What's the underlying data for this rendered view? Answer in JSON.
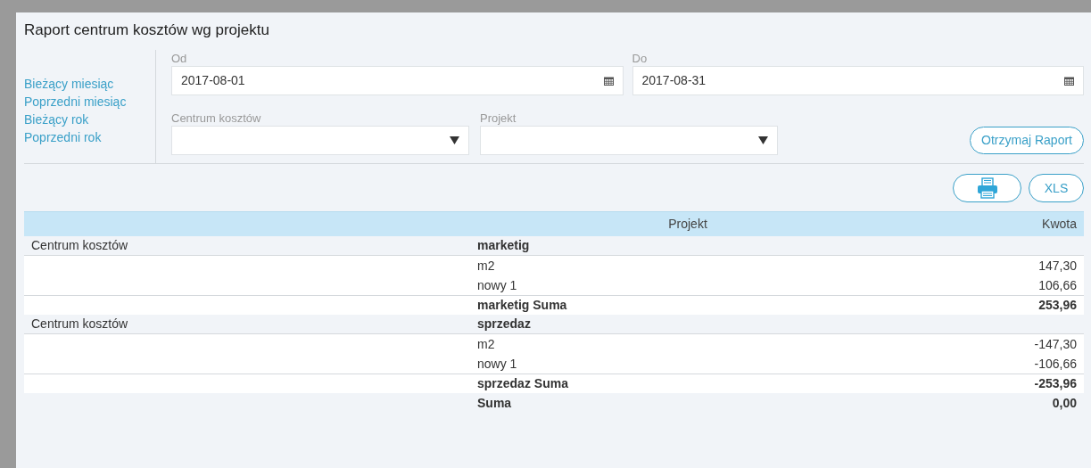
{
  "title": "Raport centrum kosztów wg projektu",
  "quick_ranges": [
    "Bieżący miesiąc",
    "Poprzedni miesiąc",
    "Bieżący rok",
    "Poprzedni rok"
  ],
  "date_from": {
    "label": "Od",
    "value": "2017-08-01"
  },
  "date_to": {
    "label": "Do",
    "value": "2017-08-31"
  },
  "cost_center": {
    "label": "Centrum kosztów"
  },
  "project": {
    "label": "Projekt"
  },
  "get_report_button": "Otrzymaj Raport",
  "export_buttons": [
    {
      "kind": "pdf"
    },
    {
      "kind": "xls",
      "label": "XLS"
    }
  ],
  "table": {
    "columns": [
      "Projekt",
      "Kwota"
    ],
    "rows": [
      {
        "kind": "group",
        "cost_center": "Centrum kosztów",
        "project": "marketig"
      },
      {
        "kind": "item",
        "project": "m2",
        "amount": "147,30"
      },
      {
        "kind": "item",
        "project": "nowy 1",
        "amount": "106,66"
      },
      {
        "kind": "subtotal",
        "project": "marketig Suma",
        "amount": "253,96"
      },
      {
        "kind": "group",
        "cost_center": "Centrum kosztów",
        "project": "sprzedaz"
      },
      {
        "kind": "item",
        "project": "m2",
        "amount": "-147,30"
      },
      {
        "kind": "item",
        "project": "nowy 1",
        "amount": "-106,66"
      },
      {
        "kind": "subtotal",
        "project": "sprzedaz Suma",
        "amount": "-253,96"
      },
      {
        "kind": "total",
        "project": "Suma",
        "amount": "0,00"
      }
    ]
  }
}
